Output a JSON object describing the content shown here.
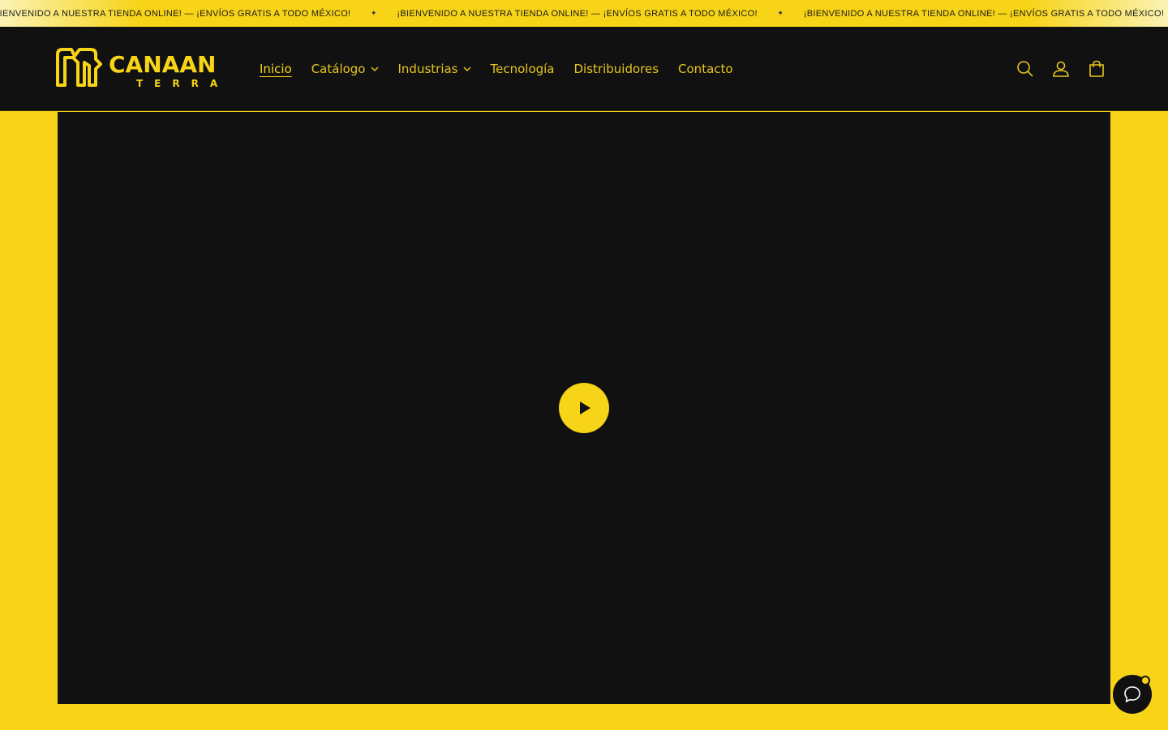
{
  "announcement": {
    "messages": [
      "¡BIENVENIDO A NUESTRA TIENDA ONLINE! — ¡ENVÍOS GRATIS A TODO MÉXICO!",
      "¡BIENVENIDO A NUESTRA TIENDA ONLINE! — ¡ENVÍOS GRATIS A TODO MÉXICO!",
      "¡BIENVENIDO A NUESTRA TIENDA ONLINE! — ¡ENVÍOS GRATIS A TODO MÉXICO!"
    ],
    "separator": "✦"
  },
  "header": {
    "logo": {
      "brand": "CANAAN",
      "sub": "TERRA"
    },
    "nav": [
      {
        "label": "Inicio",
        "active": true,
        "dropdown": false
      },
      {
        "label": "Catálogo",
        "active": false,
        "dropdown": true
      },
      {
        "label": "Industrias",
        "active": false,
        "dropdown": true
      },
      {
        "label": "Tecnología",
        "active": false,
        "dropdown": false
      },
      {
        "label": "Distribuidores",
        "active": false,
        "dropdown": false
      },
      {
        "label": "Contacto",
        "active": false,
        "dropdown": false
      }
    ],
    "icons": [
      "search-icon",
      "account-icon",
      "cart-icon"
    ]
  },
  "video": {
    "play_icon": "play-icon"
  },
  "chat": {
    "icon": "chat-icon"
  },
  "colors": {
    "accent": "#f7d417",
    "dark": "#111111",
    "nav_text": "#e8c61e"
  }
}
